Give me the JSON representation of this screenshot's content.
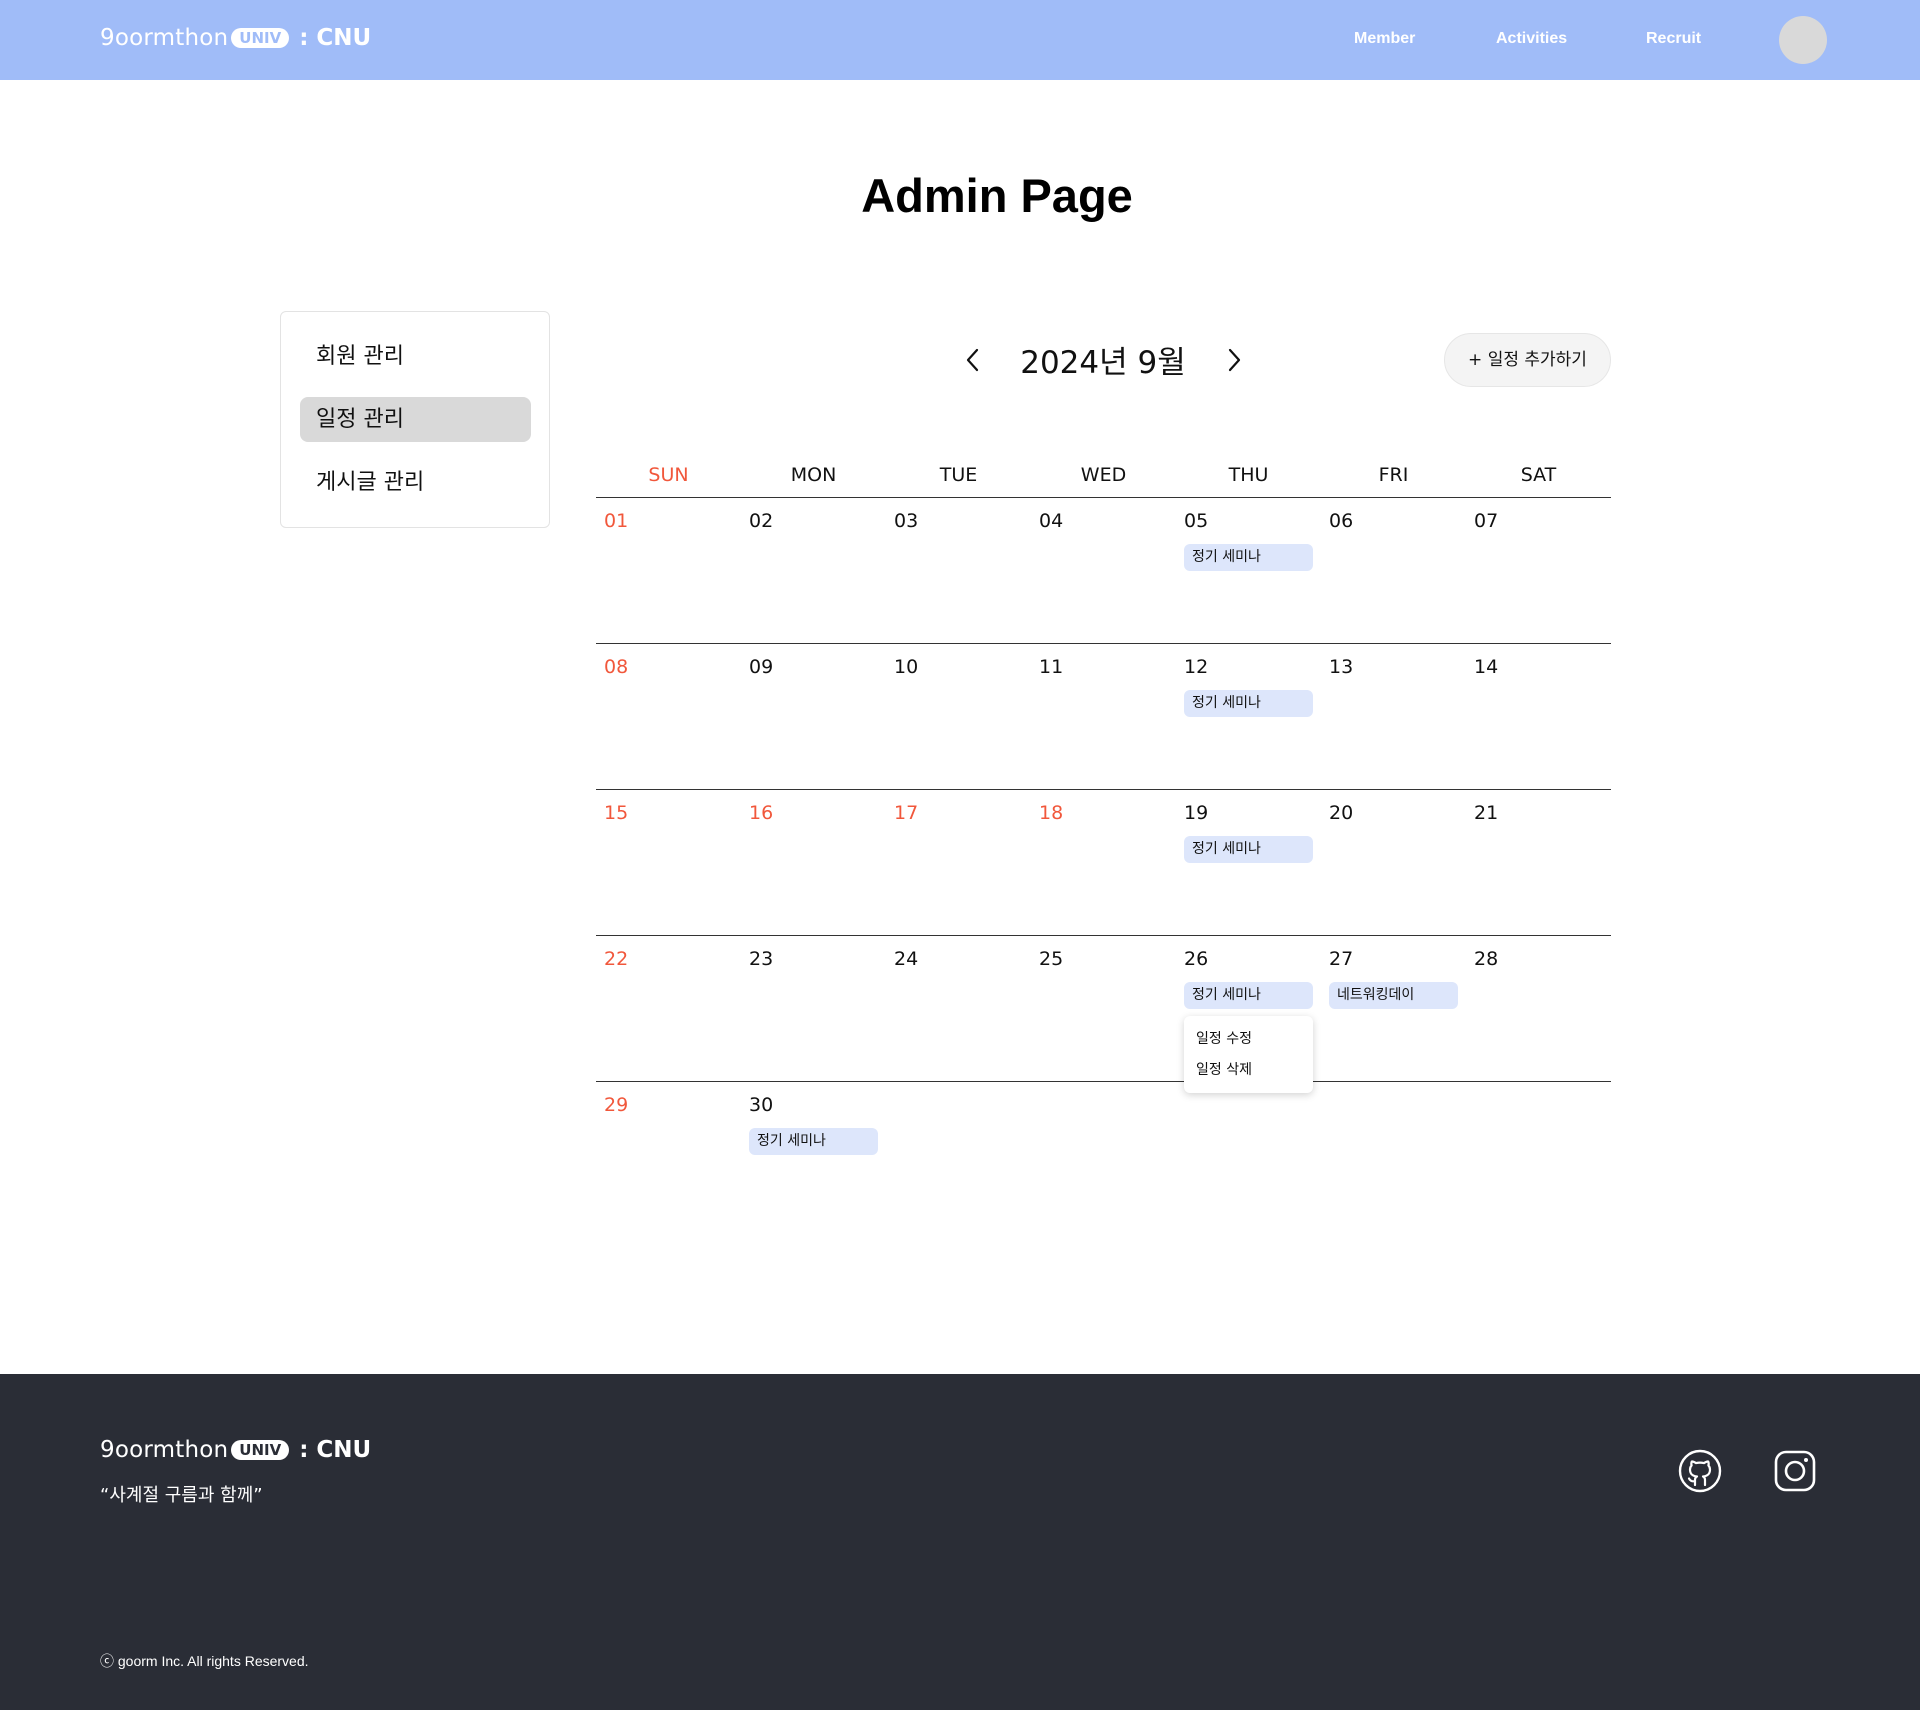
{
  "header": {
    "logo": {
      "wordmark": "9oormthon",
      "badge": "UNIV",
      "suffix": ": CNU"
    },
    "nav": [
      "Member",
      "Activities",
      "Recruit"
    ]
  },
  "page_title": "Admin Page",
  "sidebar": {
    "items": [
      {
        "label": "회원 관리",
        "active": false
      },
      {
        "label": "일정 관리",
        "active": true
      },
      {
        "label": "게시글 관리",
        "active": false
      }
    ]
  },
  "calendar": {
    "month_label": "2024년 9월",
    "prev_icon": "chevron-left-icon",
    "next_icon": "chevron-right-icon",
    "add_button": "+ 일정 추가하기",
    "weekdays": [
      "SUN",
      "MON",
      "TUE",
      "WED",
      "THU",
      "FRI",
      "SAT"
    ],
    "weeks": [
      [
        "01",
        "02",
        "03",
        "04",
        "05",
        "06",
        "07"
      ],
      [
        "08",
        "09",
        "10",
        "11",
        "12",
        "13",
        "14"
      ],
      [
        "15",
        "16",
        "17",
        "18",
        "19",
        "20",
        "21"
      ],
      [
        "22",
        "23",
        "24",
        "25",
        "26",
        "27",
        "28"
      ],
      [
        "29",
        "30"
      ]
    ],
    "holidays": [
      "16",
      "17",
      "18"
    ],
    "events": [
      {
        "date": "05",
        "title": "정기 세미나"
      },
      {
        "date": "12",
        "title": "정기 세미나"
      },
      {
        "date": "19",
        "title": "정기 세미나"
      },
      {
        "date": "26",
        "title": "정기 세미나"
      },
      {
        "date": "27",
        "title": "네트워킹데이"
      },
      {
        "date": "30",
        "title": "정기 세미나"
      }
    ],
    "context_menu": {
      "edit": "일정 수정",
      "delete": "일정 삭제"
    }
  },
  "footer": {
    "logo": {
      "wordmark": "9oormthon",
      "badge": "UNIV",
      "suffix": ": CNU"
    },
    "tagline": "“사계절 구름과 함께”",
    "social_icons": [
      "github-icon",
      "instagram-icon"
    ],
    "copyright": "ⓒ goorm Inc. All rights Reserved."
  },
  "colors": {
    "header_bg": "#a0bcf8",
    "footer_bg": "#2a2d36",
    "sunday_red": "#f1573b",
    "event_bg": "#dde6fb",
    "active_item_bg": "#d9d9d9"
  }
}
